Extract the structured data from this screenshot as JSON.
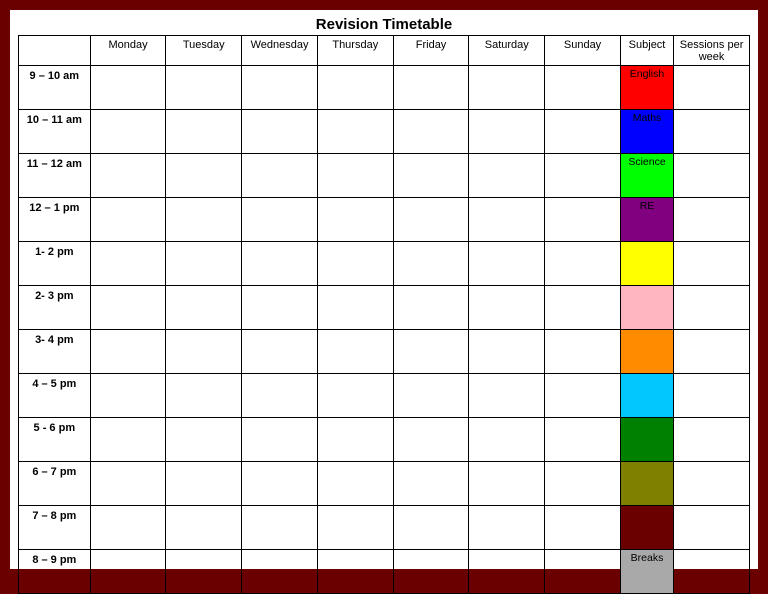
{
  "title": "Revision Timetable",
  "headers": {
    "time": "",
    "days": [
      "Monday",
      "Tuesday",
      "Wednesday",
      "Thursday",
      "Friday",
      "Saturday",
      "Sunday"
    ],
    "subject": "Subject",
    "sessions": "Sessions per week"
  },
  "rows": [
    {
      "time": "9 – 10 am",
      "subject_color": "#ff0000",
      "subject_label": "English",
      "subject_text_color": "#000"
    },
    {
      "time": "10 – 11 am",
      "subject_color": "#0000ff",
      "subject_label": "Maths",
      "subject_text_color": "#000"
    },
    {
      "time": "11 – 12 am",
      "subject_color": "#00ff00",
      "subject_label": "Science",
      "subject_text_color": "#000"
    },
    {
      "time": "12 – 1 pm",
      "subject_color": "#800080",
      "subject_label": "RE",
      "subject_text_color": "#000"
    },
    {
      "time": "1- 2 pm",
      "subject_color": "#ffff00",
      "subject_label": "",
      "subject_text_color": "#000"
    },
    {
      "time": "2- 3 pm",
      "subject_color": "#ffb6c1",
      "subject_label": "",
      "subject_text_color": "#000"
    },
    {
      "time": "3- 4 pm",
      "subject_color": "#ff8c00",
      "subject_label": "",
      "subject_text_color": "#000"
    },
    {
      "time": "4 – 5 pm",
      "subject_color": "#00c8ff",
      "subject_label": "",
      "subject_text_color": "#000"
    },
    {
      "time": "5 - 6 pm",
      "subject_color": "#008000",
      "subject_label": "",
      "subject_text_color": "#000"
    },
    {
      "time": "6 – 7 pm",
      "subject_color": "#808000",
      "subject_label": "",
      "subject_text_color": "#000"
    },
    {
      "time": "7 – 8 pm",
      "subject_color": "#6b0000",
      "subject_label": "",
      "subject_text_color": "#000"
    },
    {
      "time": "8 – 9 pm",
      "subject_color": "#a9a9a9",
      "subject_label": "Breaks",
      "subject_text_color": "#000"
    }
  ]
}
